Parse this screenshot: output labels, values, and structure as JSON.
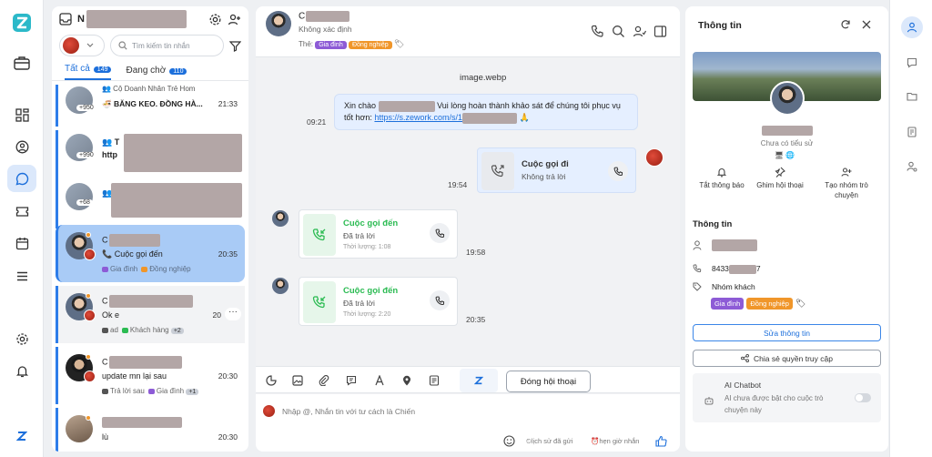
{
  "list": {
    "header_initial": "N",
    "search_placeholder": "Tìm kiếm tin nhắn",
    "tab_all": "Tất cả",
    "tab_all_count": "149",
    "tab_wait": "Đang chờ",
    "tab_wait_count": "110",
    "rows": [
      {
        "prefix": "👥 Cộ Doanh Nhân Trẻ Hom",
        "count": "+950",
        "msg": "BĂNG KEO. ĐỒNG HÀ...",
        "time": "21:33"
      },
      {
        "prefix": "👥 T",
        "count": "+990",
        "msg": "http"
      },
      {
        "prefix": "👥",
        "count": "+68",
        "msg": ""
      },
      {
        "name": "C",
        "msg": "Cuộc gọi đến",
        "time": "20:35",
        "tag1": "Gia đình",
        "tag2": "Đồng nghiệp"
      },
      {
        "name": "C",
        "msg": "Ok e",
        "time": "20",
        "tag1": "ad",
        "tag2": "Khách hàng",
        "extra": "+2"
      },
      {
        "name": "C",
        "msg": "update mn lại sau",
        "time": "20:30",
        "tag1": "Trả lời sau",
        "tag2": "Gia đình",
        "extra": "+1"
      },
      {
        "name": "",
        "msg": "lù",
        "time": "20:30"
      }
    ]
  },
  "chat": {
    "name": "C",
    "status": "Không xác định",
    "tag_label": "Thẻ:",
    "tag1": "Gia đình",
    "tag2": "Đồng nghiệp",
    "file_name": "image.webp",
    "msg_pre": "Xin chào",
    "msg_post": "Vui lòng hoàn thành khảo sát để chúng tôi phục vụ",
    "msg_line2": "tốt hơn:",
    "msg_link": "https://s.zework.com/s/1",
    "msg_time": "09:21",
    "out_call_title": "Cuộc gọi đi",
    "out_call_sub": "Không trả lời",
    "out_call_time": "19:54",
    "in_call_title": "Cuộc gọi đến",
    "in_call_sub": "Đã trả lời",
    "in_call1_dur": "Thời lượng: 1:08",
    "in_call1_time": "19:58",
    "in_call2_dur": "Thời lượng: 2:20",
    "in_call2_time": "20:35",
    "end_button": "Đóng hội thoại",
    "input_placeholder": "Nhập @, Nhắn tin với tư cách là Chiến",
    "history": "lịch sử đã gửi",
    "schedule": "hẹn giờ nhắn"
  },
  "info": {
    "title": "Thông tin",
    "no_story": "Chưa có tiểu sử",
    "act_mute": "Tắt thông báo",
    "act_pin": "Ghim hội thoại",
    "act_group": "Tạo nhóm trò chuyện",
    "section": "Thông tin",
    "phone_prefix": "8433",
    "phone_suffix": "7",
    "group_label": "Nhóm khách",
    "tag1": "Gia đình",
    "tag2": "Đồng nghiệp",
    "edit_button": "Sửa thông tin",
    "share_button": "Chia sẻ quyền truy cập",
    "bot_title": "AI Chatbot",
    "bot_desc": "AI chưa được bật cho cuộc trò chuyện này"
  },
  "colors": {
    "accent": "#1c6fdb",
    "purple": "#8d5bd6",
    "orange": "#f0962a",
    "green": "#2bbb52"
  }
}
